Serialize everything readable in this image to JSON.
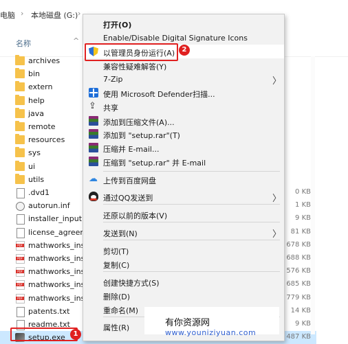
{
  "breadcrumb": {
    "segments": [
      "电脑",
      "本地磁盘 (G:)"
    ],
    "separator": "›"
  },
  "header": {
    "name_col": "名称",
    "sort_glyph": "^"
  },
  "files": [
    {
      "name": "archives",
      "type": "folder",
      "size": ""
    },
    {
      "name": "bin",
      "type": "folder",
      "size": ""
    },
    {
      "name": "extern",
      "type": "folder",
      "size": ""
    },
    {
      "name": "help",
      "type": "folder",
      "size": ""
    },
    {
      "name": "java",
      "type": "folder",
      "size": ""
    },
    {
      "name": "remote",
      "type": "folder",
      "size": ""
    },
    {
      "name": "resources",
      "type": "folder",
      "size": ""
    },
    {
      "name": "sys",
      "type": "folder",
      "size": ""
    },
    {
      "name": "ui",
      "type": "folder",
      "size": ""
    },
    {
      "name": "utils",
      "type": "folder",
      "size": ""
    },
    {
      "name": ".dvd1",
      "type": "doc",
      "size": "0 KB"
    },
    {
      "name": "autorun.inf",
      "type": "disc",
      "size": "1 KB"
    },
    {
      "name": "installer_input.t",
      "type": "doc",
      "size": "9 KB"
    },
    {
      "name": "license_agreem",
      "type": "doc",
      "size": "81 KB"
    },
    {
      "name": "mathworks_inst",
      "type": "pdf",
      "size": "678 KB"
    },
    {
      "name": "mathworks_inst",
      "type": "pdf",
      "size": "688 KB"
    },
    {
      "name": "mathworks_inst",
      "type": "pdf",
      "size": "576 KB"
    },
    {
      "name": "mathworks_inst",
      "type": "pdf",
      "size": "685 KB"
    },
    {
      "name": "mathworks_inst",
      "type": "pdf",
      "size": "779 KB"
    },
    {
      "name": "patents.txt",
      "type": "doc",
      "size": "14 KB"
    },
    {
      "name": "readme.txt",
      "type": "doc",
      "size": "9 KB"
    },
    {
      "name": "setup.exe",
      "type": "setup",
      "size": "487 KB"
    }
  ],
  "callouts": {
    "step1": "1",
    "step2": "2"
  },
  "context_menu": {
    "items": [
      {
        "label": "打开(O)",
        "bold": true,
        "icon": ""
      },
      {
        "label": "Enable/Disable Digital Signature Icons",
        "icon": ""
      },
      {
        "label": "以管理员身份运行(A)",
        "icon": "shield-icon"
      },
      {
        "label": "兼容性疑难解答(Y)",
        "icon": ""
      },
      {
        "label": "7-Zip",
        "icon": "",
        "submenu": true
      },
      {
        "label": "使用 Microsoft Defender扫描...",
        "icon": "defender-icon"
      },
      {
        "label": "共享",
        "icon": "share-icon"
      },
      {
        "label": "添加到压缩文件(A)...",
        "icon": "winrar-icon"
      },
      {
        "label": "添加到 \"setup.rar\"(T)",
        "icon": "winrar-icon"
      },
      {
        "label": "压缩并 E-mail...",
        "icon": "winrar-icon"
      },
      {
        "label": "压缩到 \"setup.rar\" 并 E-mail",
        "icon": "winrar-icon"
      },
      {
        "label": "上传到百度网盘",
        "icon": "baidu-cloud-icon"
      },
      {
        "label": "通过QQ发送到",
        "icon": "qq-icon",
        "submenu": true
      },
      {
        "label": "还原以前的版本(V)",
        "icon": ""
      },
      {
        "label": "发送到(N)",
        "icon": "",
        "submenu": true
      },
      {
        "label": "剪切(T)",
        "icon": ""
      },
      {
        "label": "复制(C)",
        "icon": ""
      },
      {
        "label": "创建快捷方式(S)",
        "icon": ""
      },
      {
        "label": "删除(D)",
        "icon": ""
      },
      {
        "label": "重命名(M)",
        "icon": ""
      },
      {
        "label": "属性(R)",
        "icon": ""
      }
    ],
    "submenu_glyph": "〉"
  },
  "watermark": {
    "title": "有你资源网",
    "url": "www.youniziyuan.com"
  },
  "colors": {
    "accent_red": "#e02020",
    "selection": "#cce8ff",
    "folder": "#f6c24b"
  }
}
